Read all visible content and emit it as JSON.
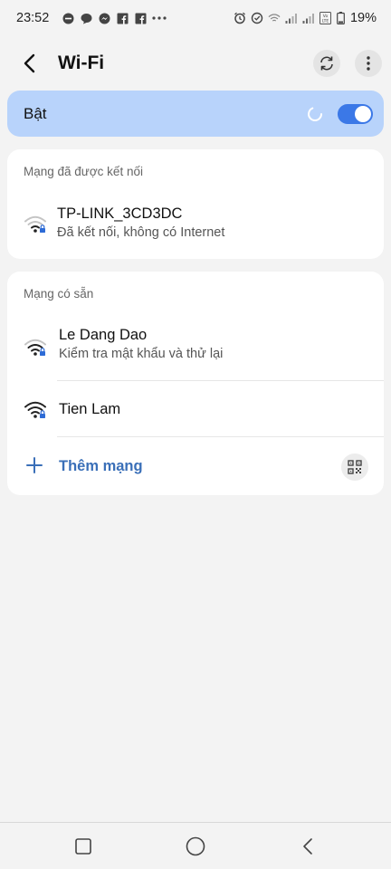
{
  "status_bar": {
    "time": "23:52",
    "left_icons": [
      "do-not-disturb-icon",
      "chat-bubble-icon",
      "messenger-icon",
      "facebook-icon",
      "facebook-icon",
      "more-dots-icon"
    ],
    "right_icons": [
      "alarm-icon",
      "data-saver-icon",
      "wifi-icon",
      "signal-icon",
      "signal-icon",
      "volte-icon",
      "battery-icon"
    ],
    "battery": "19%"
  },
  "header": {
    "title": "Wi-Fi"
  },
  "toggle": {
    "label": "Bật",
    "on": true
  },
  "connected_section": {
    "header": "Mạng đã được kết nối",
    "network": {
      "name": "TP-LINK_3CD3DC",
      "status": "Đã kết nối, không có Internet"
    }
  },
  "available_section": {
    "header": "Mạng có sẵn",
    "networks": [
      {
        "name": "Le Dang Dao",
        "status": "Kiểm tra mật khẩu và thử lại",
        "locked": true
      },
      {
        "name": "Tien Lam",
        "status": "",
        "locked": true
      }
    ],
    "add_label": "Thêm mạng"
  },
  "colors": {
    "accent": "#3b78e7",
    "toggle_bar": "#b8d3fb",
    "add_text": "#3a6fb8",
    "background": "#f3f3f3"
  }
}
